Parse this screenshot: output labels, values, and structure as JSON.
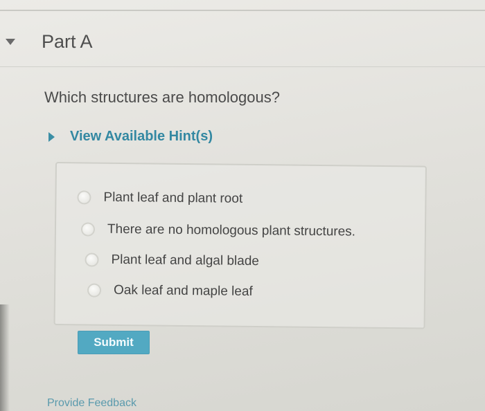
{
  "part": {
    "title": "Part A"
  },
  "question": {
    "text": "Which structures are homologous?"
  },
  "hint": {
    "label": "View Available Hint(s)"
  },
  "options": [
    {
      "label": "Plant leaf and plant root",
      "selected": false
    },
    {
      "label": "There are no homologous plant structures.",
      "selected": false
    },
    {
      "label": "Plant leaf and algal blade",
      "selected": false
    },
    {
      "label": "Oak leaf and maple leaf",
      "selected": false
    }
  ],
  "actions": {
    "submit_label": "Submit",
    "feedback_label": "Provide Feedback"
  },
  "colors": {
    "accent": "#52a9c2",
    "link": "#3388a2"
  }
}
